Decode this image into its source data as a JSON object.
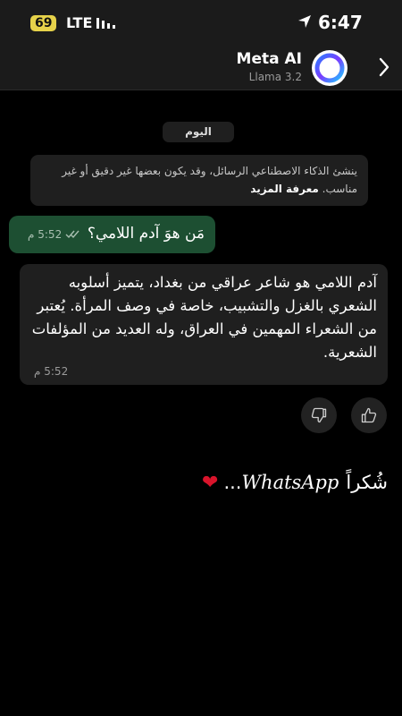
{
  "status_bar": {
    "battery": "69",
    "network": "LTE",
    "time": "6:47"
  },
  "header": {
    "name": "Meta AI",
    "subtitle": "Llama 3.2"
  },
  "chat": {
    "date_chip": "اليوم",
    "notice": {
      "text": "ينشئ الذكاء الاصطناعي الرسائل، وقد يكون بعضها غير دقيق أو غير مناسب.",
      "link": "معرفة المزيد"
    },
    "outgoing": {
      "text": "مَن هوَ آدم اللامي؟",
      "time": "5:52 م"
    },
    "incoming": {
      "text": "آدم اللامي هو شاعر عراقي من بغداد، يتميز أسلوبه الشعري بالغزل والتشبيب، خاصة في وصف المرأة. يُعتبر من الشعراء المهمين في العراق، وله العديد من المؤلفات الشعرية.",
      "time": "5:52 م"
    }
  },
  "caption": {
    "prefix": "شُكراً",
    "brand": "WhatsApp",
    "suffix": "..."
  },
  "colors": {
    "outgoing_bubble": "#1d4f32",
    "incoming_bubble": "#1f1f1f",
    "heart": "#d9142b",
    "battery": "#e6d24a"
  }
}
